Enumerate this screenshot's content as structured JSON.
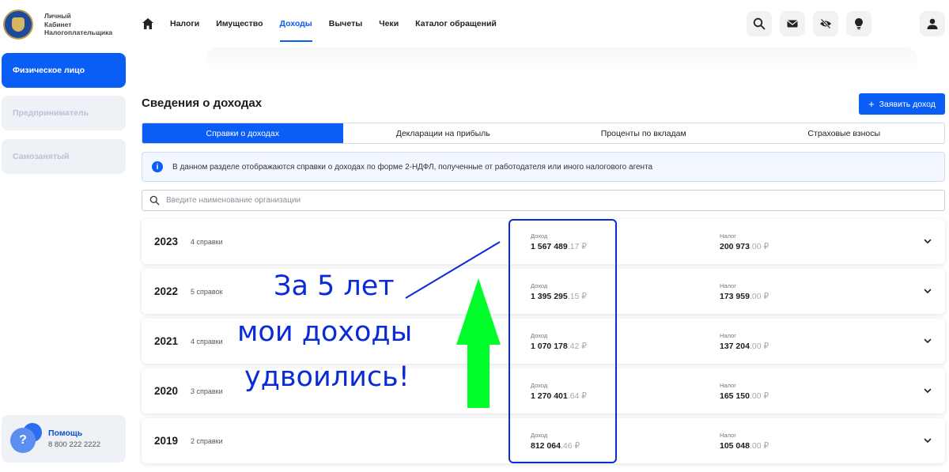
{
  "logo": {
    "line1": "Личный",
    "line2": "Кабинет",
    "line3": "Налогоплательщика"
  },
  "nav": {
    "items": [
      {
        "label": "Налоги"
      },
      {
        "label": "Имущество"
      },
      {
        "label": "Доходы"
      },
      {
        "label": "Вычеты"
      },
      {
        "label": "Чеки"
      },
      {
        "label": "Каталог обращений"
      }
    ],
    "active": "Доходы"
  },
  "header_icons": [
    "search-icon",
    "mail-icon",
    "eye-off-icon",
    "lightbulb-icon",
    "user-icon"
  ],
  "sidebar": {
    "items": [
      {
        "label": "Физическое лицо"
      },
      {
        "label": "Предприниматель"
      },
      {
        "label": "Самозанятый"
      }
    ],
    "help": {
      "title": "Помощь",
      "phone": "8 800 222 2222"
    }
  },
  "main": {
    "title": "Сведения о доходах",
    "add_button": "Заявить доход",
    "tabs": [
      {
        "label": "Справки о доходах"
      },
      {
        "label": "Декларации на прибыль"
      },
      {
        "label": "Проценты по вкладам"
      },
      {
        "label": "Страховые взносы"
      }
    ],
    "info": "В данном разделе отображаются справки о доходах по форме 2-НДФЛ, полученные от работодателя или иного налогового агента",
    "search_placeholder": "Введите наименование организации",
    "income_label": "Доход",
    "tax_label": "Налог",
    "years": [
      {
        "year": "2023",
        "count": "4 справки",
        "income_main": "1 567 489",
        "income_frac": ".17 ₽",
        "tax_main": "200 973",
        "tax_frac": ".00 ₽"
      },
      {
        "year": "2022",
        "count": "5 справок",
        "income_main": "1 395 295",
        "income_frac": ".15 ₽",
        "tax_main": "173 959",
        "tax_frac": ".00 ₽"
      },
      {
        "year": "2021",
        "count": "4 справки",
        "income_main": "1 070 178",
        "income_frac": ".42 ₽",
        "tax_main": "137 204",
        "tax_frac": ".00 ₽"
      },
      {
        "year": "2020",
        "count": "3 справки",
        "income_main": "1 270 401",
        "income_frac": ".64 ₽",
        "tax_main": "165 150",
        "tax_frac": ".00 ₽"
      },
      {
        "year": "2019",
        "count": "2 справки",
        "income_main": "812 064",
        "income_frac": ".46 ₽",
        "tax_main": "105 048",
        "tax_frac": ".00 ₽"
      }
    ]
  },
  "annotation": {
    "line1": "За 5 лет",
    "line2": "мои доходы",
    "line3": "удвоились!",
    "text_color": "#0a2bd6",
    "arrow_color": "#00ff2a"
  },
  "colors": {
    "accent": "#0a5ef5",
    "sidebar_inactive_bg": "#eef1f6"
  }
}
